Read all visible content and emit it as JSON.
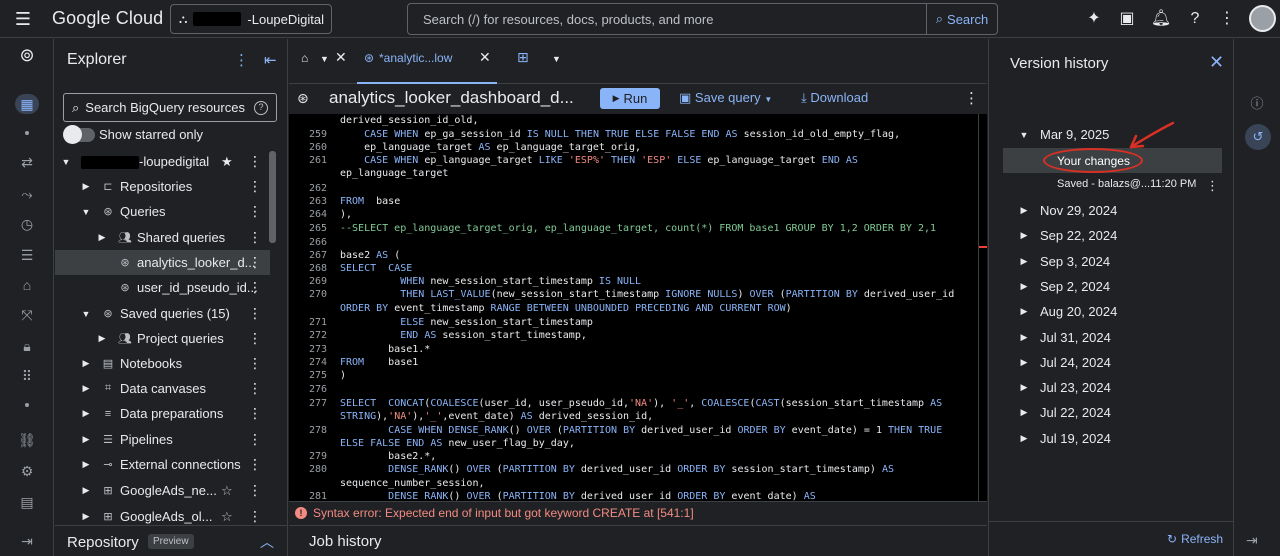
{
  "topbar": {
    "brand": "Google Cloud",
    "project": "-LoupeDigital",
    "search_placeholder": "Search (/) for resources, docs, products, and more",
    "search_button": "Search"
  },
  "explorer": {
    "title": "Explorer",
    "search_label": "Search BigQuery resources",
    "toggle_label": "Show starred only",
    "project_name": "-loupedigital",
    "items": [
      {
        "label": "Repositories"
      },
      {
        "label": "Queries"
      },
      {
        "label": "Shared queries"
      },
      {
        "label": "analytics_looker_d..."
      },
      {
        "label": "user_id_pseudo_id..."
      },
      {
        "label": "Saved queries (15)"
      },
      {
        "label": "Project queries"
      },
      {
        "label": "Notebooks"
      },
      {
        "label": "Data canvases"
      },
      {
        "label": "Data preparations"
      },
      {
        "label": "Pipelines"
      },
      {
        "label": "External connections"
      },
      {
        "label": "GoogleAds_ne..."
      },
      {
        "label": "GoogleAds_ol..."
      }
    ],
    "repository_label": "Repository",
    "preview_badge": "Preview"
  },
  "editor": {
    "tab_label": "*analytic...low",
    "query_title": "analytics_looker_dashboard_d...",
    "run_label": "Run",
    "save_label": "Save query",
    "download_label": "Download",
    "error_text": "Syntax error: Expected end of input but got keyword CREATE at [541:1]",
    "job_history": "Job history"
  },
  "code_lines": [
    {
      "n": "",
      "t": "derived_session_id_old,"
    },
    {
      "n": "259",
      "t": "    CASE WHEN ep_ga_session_id IS NULL THEN TRUE ELSE FALSE END AS session_id_old_empty_flag,"
    },
    {
      "n": "260",
      "t": "    ep_language_target AS ep_language_target_orig,"
    },
    {
      "n": "261",
      "t": "    CASE WHEN ep_language_target LIKE 'ESP%' THEN 'ESP' ELSE ep_language_target END AS"
    },
    {
      "n": "",
      "t": "ep_language_target"
    },
    {
      "n": "262",
      "t": ""
    },
    {
      "n": "263",
      "t": "FROM  base"
    },
    {
      "n": "264",
      "t": "),"
    },
    {
      "n": "265",
      "t": "--SELECT ep_language_target_orig, ep_language_target, count(*) FROM base1 GROUP BY 1,2 ORDER BY 2,1"
    },
    {
      "n": "266",
      "t": ""
    },
    {
      "n": "267",
      "t": "base2 AS ("
    },
    {
      "n": "268",
      "t": "SELECT  CASE"
    },
    {
      "n": "269",
      "t": "          WHEN new_session_start_timestamp IS NULL"
    },
    {
      "n": "270",
      "t": "          THEN LAST_VALUE(new_session_start_timestamp IGNORE NULLS) OVER (PARTITION BY derived_user_id"
    },
    {
      "n": "",
      "t": "ORDER BY event_timestamp RANGE BETWEEN UNBOUNDED PRECEDING AND CURRENT ROW)"
    },
    {
      "n": "271",
      "t": "          ELSE new_session_start_timestamp"
    },
    {
      "n": "272",
      "t": "          END AS session_start_timestamp,"
    },
    {
      "n": "273",
      "t": "        base1.*"
    },
    {
      "n": "274",
      "t": "FROM    base1"
    },
    {
      "n": "275",
      "t": ")"
    },
    {
      "n": "276",
      "t": ""
    },
    {
      "n": "277",
      "t": "SELECT  CONCAT(COALESCE(user_id, user_pseudo_id,'NA'), '_', COALESCE(CAST(session_start_timestamp AS"
    },
    {
      "n": "",
      "t": "STRING),'NA'),'_',event_date) AS derived_session_id,"
    },
    {
      "n": "278",
      "t": "        CASE WHEN DENSE_RANK() OVER (PARTITION BY derived_user_id ORDER BY event_date) = 1 THEN TRUE"
    },
    {
      "n": "",
      "t": "ELSE FALSE END AS new_user_flag_by_day,"
    },
    {
      "n": "279",
      "t": "        base2.*,"
    },
    {
      "n": "280",
      "t": "        DENSE_RANK() OVER (PARTITION BY derived_user_id ORDER BY session_start_timestamp) AS"
    },
    {
      "n": "",
      "t": "sequence_number_session,"
    },
    {
      "n": "281",
      "t": "        DENSE_RANK() OVER (PARTITION BY derived_user_id ORDER BY event_date) AS"
    }
  ],
  "version_history": {
    "title": "Version history",
    "expanded_date": "Mar 9, 2025",
    "your_changes": "Your changes",
    "saved_text": "Saved - balazs@...11:20 PM",
    "dates": [
      "Nov 29, 2024",
      "Sep 22, 2024",
      "Sep 3, 2024",
      "Sep 2, 2024",
      "Aug 20, 2024",
      "Jul 31, 2024",
      "Jul 24, 2024",
      "Jul 23, 2024",
      "Jul 22, 2024",
      "Jul 19, 2024"
    ],
    "refresh_label": "Refresh"
  }
}
